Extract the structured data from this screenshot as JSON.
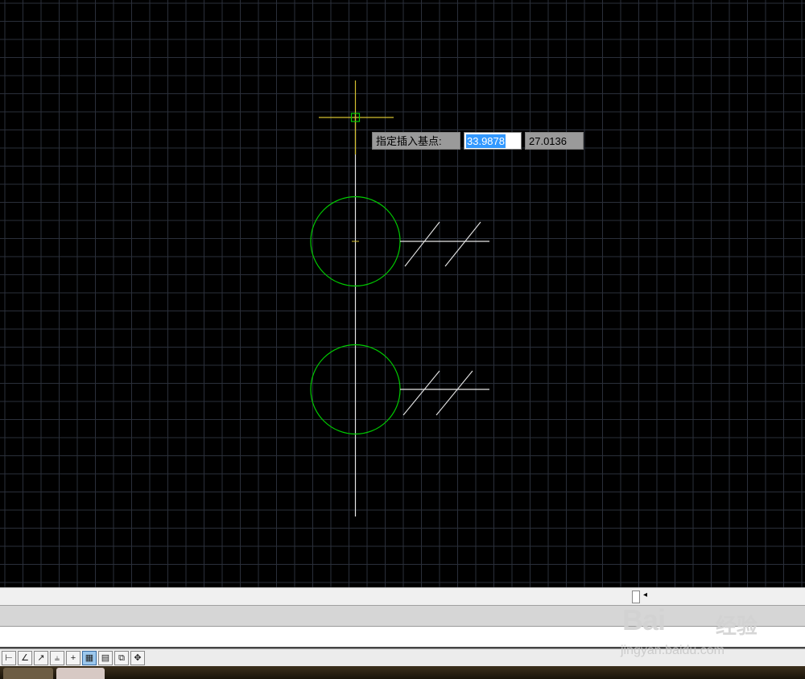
{
  "dynamic_input": {
    "prompt": "指定插入基点:",
    "x_value": "33.9878",
    "y_value": "27.0136"
  },
  "colors": {
    "background": "#000000",
    "grid": "#2a2f3a",
    "circle": "#00cc00",
    "line": "#e6e6e6",
    "crosshair": "#d4c030",
    "highlight": "#3399ff"
  },
  "statusbar": {
    "buttons": [
      {
        "icon": "snap-icon",
        "glyph": "⊢"
      },
      {
        "icon": "angle-icon",
        "glyph": "∠"
      },
      {
        "icon": "ucs-icon",
        "glyph": "↗"
      },
      {
        "icon": "lineweight-icon",
        "glyph": "⫨"
      },
      {
        "icon": "ortho-icon",
        "glyph": "+"
      },
      {
        "icon": "grid-icon",
        "glyph": "▦"
      },
      {
        "icon": "model-icon",
        "glyph": "▤"
      },
      {
        "icon": "selection-icon",
        "glyph": "⧉"
      },
      {
        "icon": "move-icon",
        "glyph": "✥"
      }
    ]
  },
  "watermark": {
    "brand": "Bai",
    "brand_suffix": "经验",
    "url": "jingyan.baidu.com"
  }
}
